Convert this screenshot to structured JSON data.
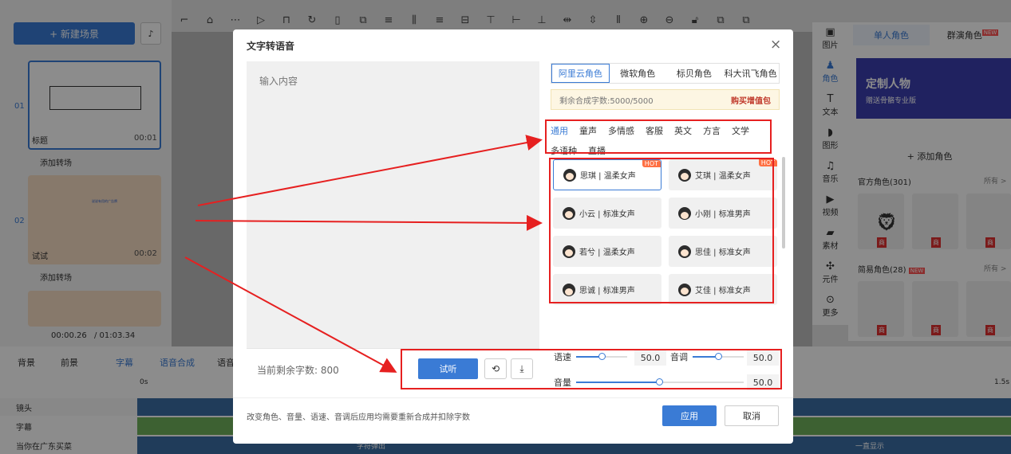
{
  "left_panel": {
    "new_scene_label": "+ 新建场景",
    "scenes": [
      {
        "number": "01",
        "name": "标题",
        "time": "00:01"
      },
      {
        "number": "02",
        "name": "试试",
        "time": "00:02"
      }
    ],
    "add_transition": "添加转场",
    "thumb2_text": "说说有用的广告牌",
    "timecode": "00:00.26",
    "total": "/ 01:03.34"
  },
  "right_sidebar": {
    "items": [
      "图片",
      "角色",
      "文本",
      "图形",
      "音乐",
      "视频",
      "素材",
      "元件",
      "更多"
    ]
  },
  "right_panel": {
    "tab_single": "单人角色",
    "tab_group": "群演角色",
    "tab_group_badge": "NEW",
    "banner_title": "定制人物",
    "banner_sub": "赠送骨骼专业版",
    "add_role": "+ 添加角色",
    "official_label": "官方角色(301)",
    "all_label": "所有 >",
    "simple_label": "简易角色(28)",
    "simple_badge": "NEW",
    "paid_badge": "商"
  },
  "bottom": {
    "tabs": [
      "背景",
      "前景",
      "字幕",
      "语音合成",
      "语音"
    ],
    "zero": "0s",
    "end_time": "1.5s",
    "tracks": [
      "镜头",
      "字幕",
      "当你在广东买菜"
    ],
    "track_text_1": "字符弹出",
    "track_text_2": "一直显示"
  },
  "dialog": {
    "title": "文字转语音",
    "close": "×",
    "input_placeholder": "输入内容",
    "remaining_label": "当前剩余字数: 800",
    "listen_button": "试听",
    "vendor_tabs": [
      "阿里云角色",
      "微软角色",
      "标贝角色",
      "科大讯飞角色"
    ],
    "quota_text": "剩余合成字数:5000/5000",
    "buy_label": "购买增值包",
    "categories": [
      "通用",
      "童声",
      "多情感",
      "客服",
      "英文",
      "方言",
      "文学",
      "多语种",
      "直播"
    ],
    "voices": [
      {
        "name": "思琪 | 温柔女声",
        "hot": "HOT"
      },
      {
        "name": "艾琪 | 温柔女声",
        "hot": "HOT"
      },
      {
        "name": "小云 | 标准女声",
        "hot": ""
      },
      {
        "name": "小刚 | 标准男声",
        "hot": ""
      },
      {
        "name": "若兮 | 温柔女声",
        "hot": ""
      },
      {
        "name": "思佳 | 标准女声",
        "hot": ""
      },
      {
        "name": "思诚 | 标准男声",
        "hot": ""
      },
      {
        "name": "艾佳 | 标准女声",
        "hot": ""
      }
    ],
    "speed_label": "语速",
    "speed_value": "50.0",
    "pitch_label": "音调",
    "pitch_value": "50.0",
    "volume_label": "音量",
    "volume_value": "50.0",
    "note": "改变角色、音量、语速、音调后应用均需要重新合成并扣除字数",
    "apply_button": "应用",
    "cancel_button": "取消"
  }
}
